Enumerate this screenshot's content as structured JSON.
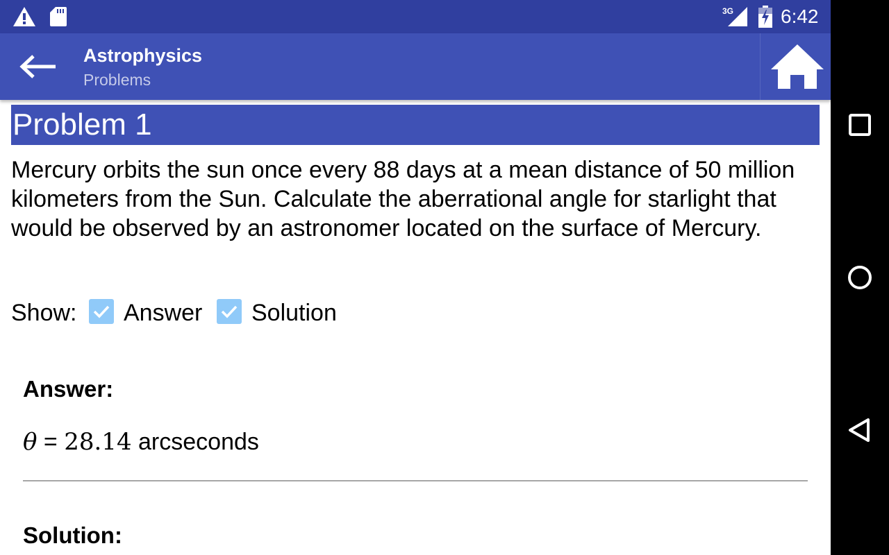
{
  "status_bar": {
    "network": "3G",
    "time": "6:42",
    "icons": [
      "warning-icon",
      "sd-card-icon",
      "signal-icon",
      "battery-charging-icon"
    ]
  },
  "app_bar": {
    "title": "Astrophysics",
    "subtitle": "Problems",
    "icons": [
      "back-arrow-icon",
      "home-icon"
    ]
  },
  "problem": {
    "heading": "Problem 1",
    "text": "Mercury orbits the sun once every 88 days at a mean distance of 50 million kilometers from the Sun. Calculate the aberrational angle for starlight that would be observed by an astronomer located on the surface of Mercury."
  },
  "show": {
    "label": "Show:",
    "answer_label": "Answer",
    "answer_checked": true,
    "solution_label": "Solution",
    "solution_checked": true
  },
  "answer": {
    "heading": "Answer:",
    "symbol": "θ",
    "equals": " = ",
    "value": "28.14",
    "unit": " arcseconds"
  },
  "solution": {
    "heading": "Solution:"
  },
  "nav_bar": {
    "icons": [
      "recents-icon",
      "home-circle-icon",
      "back-triangle-icon"
    ]
  },
  "colors": {
    "status_bar": "#303f9f",
    "primary": "#3f51b5",
    "checkbox": "#90caf9",
    "subtitle": "#c5cae9"
  }
}
